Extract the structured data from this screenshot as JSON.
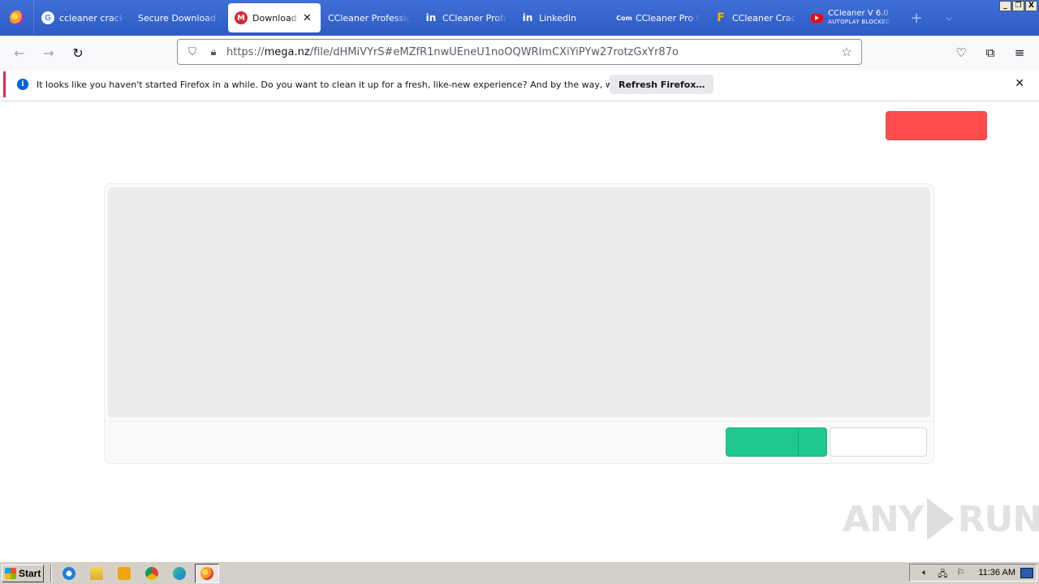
{
  "browser": {
    "tabs": [
      {
        "label": "ccleaner crack -",
        "favicon": "google-icon"
      },
      {
        "label": "Secure Download Fil",
        "favicon": "none"
      },
      {
        "label": "Download - I",
        "favicon": "mega-icon",
        "active": true
      },
      {
        "label": "CCleaner Profession",
        "favicon": "none"
      },
      {
        "label": "CCleaner Profe",
        "favicon": "linkedin-icon"
      },
      {
        "label": "LinkedIn",
        "favicon": "linkedin-icon"
      },
      {
        "label": "CCleaner Pro C",
        "favicon": "com-icon"
      },
      {
        "label": "CCleaner Crack",
        "favicon": "f-icon"
      },
      {
        "label": "CCleaner V 6.0",
        "sublabel": "AUTOPLAY BLOCKED",
        "favicon": "youtube-icon"
      }
    ],
    "new_tab": "+",
    "favicon_text": {
      "google": "G",
      "mega": "M",
      "linkedin": "in",
      "com": "Com",
      "f": "F"
    },
    "window_buttons": {
      "minimize": "_",
      "restore": "❐",
      "close": "X"
    },
    "url": {
      "prefix": "https://",
      "host": "mega.nz",
      "path": "/file/dHMiVYrS#eMZfR1nwUEneU1noOQWRImCXiYiPYw27rotzGxYr87o"
    }
  },
  "notification": {
    "message": "It looks like you haven't started Firefox in a while. Do you want to clean it up for a fresh, like-new experience? And by the way, welcome back!",
    "button": "Refresh Firefox…",
    "info_glyph": "i",
    "close_glyph": "✕"
  },
  "watermark": {
    "left": "ANY",
    "right": "RUN"
  },
  "taskbar": {
    "start_label": "Start",
    "clock": "11:36 AM"
  },
  "colors": {
    "tab_strip": "#3a67d0",
    "red_button": "#ff4d4d",
    "green_button": "#1fc98e",
    "notification_accent": "#e22850"
  }
}
